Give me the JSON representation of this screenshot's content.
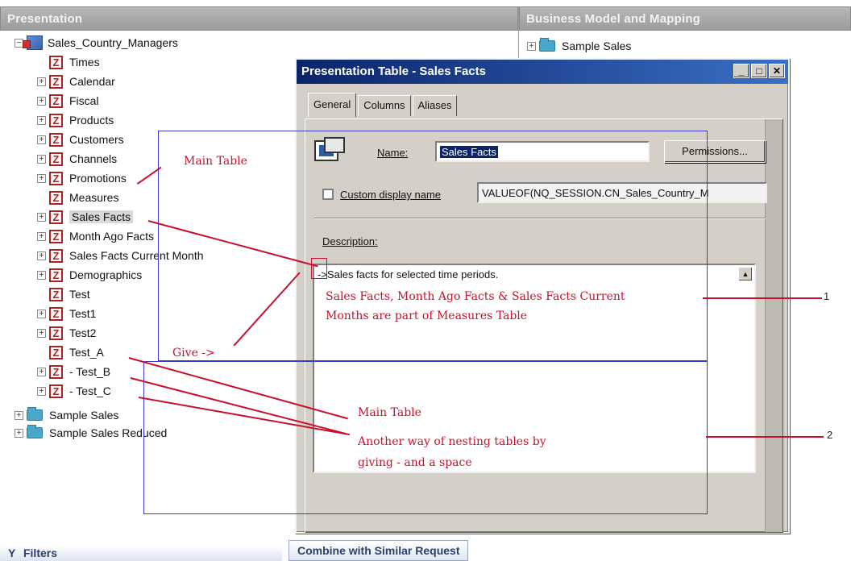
{
  "left_pane": {
    "title": "Presentation"
  },
  "right_pane": {
    "title": "Business Model and Mapping",
    "item": "Sample Sales"
  },
  "tree": {
    "root": "Sales_Country_Managers",
    "items": [
      {
        "label": "Times",
        "expandable": false
      },
      {
        "label": "Calendar",
        "expandable": true
      },
      {
        "label": "Fiscal",
        "expandable": true
      },
      {
        "label": "Products",
        "expandable": true
      },
      {
        "label": "Customers",
        "expandable": true
      },
      {
        "label": "Channels",
        "expandable": true
      },
      {
        "label": "Promotions",
        "expandable": true
      },
      {
        "label": "Measures",
        "expandable": false
      },
      {
        "label": "Sales Facts",
        "expandable": true
      },
      {
        "label": "Month Ago Facts",
        "expandable": true
      },
      {
        "label": "Sales Facts Current Month",
        "expandable": true
      },
      {
        "label": "Demographics",
        "expandable": true
      },
      {
        "label": "Test",
        "expandable": false
      },
      {
        "label": "Test1",
        "expandable": true
      },
      {
        "label": "Test2",
        "expandable": true
      },
      {
        "label": "Test_A",
        "expandable": false
      },
      {
        "label": "- Test_B",
        "expandable": true
      },
      {
        "label": "- Test_C",
        "expandable": true
      }
    ],
    "folders": [
      "Sample Sales",
      "Sample Sales Reduced"
    ]
  },
  "dialog": {
    "title": "Presentation Table - Sales Facts",
    "tabs": [
      "General",
      "Columns",
      "Aliases"
    ],
    "name_label": "Name:",
    "name_value": "Sales Facts",
    "permissions_label": "Permissions...",
    "custom_display_label": "Custom display name",
    "custom_display_value": "VALUEOF(NQ_SESSION.CN_Sales_Country_M",
    "description_label": "Description:",
    "description_value": "->Sales facts for selected time periods."
  },
  "annotations": {
    "main_table_1": "Main Table",
    "main_table_2": "Main Table",
    "give": "Give ->",
    "measures_note_line1": "Sales Facts, Month Ago Facts & Sales Facts Current",
    "measures_note_line2": "Months are part of Measures Table",
    "nesting_line1": "Another way of nesting tables by",
    "nesting_line2": "giving - and a space",
    "num1": "1",
    "num2": "2"
  },
  "bottom": {
    "filters": "Filters",
    "combine": "Combine with Similar Request"
  }
}
